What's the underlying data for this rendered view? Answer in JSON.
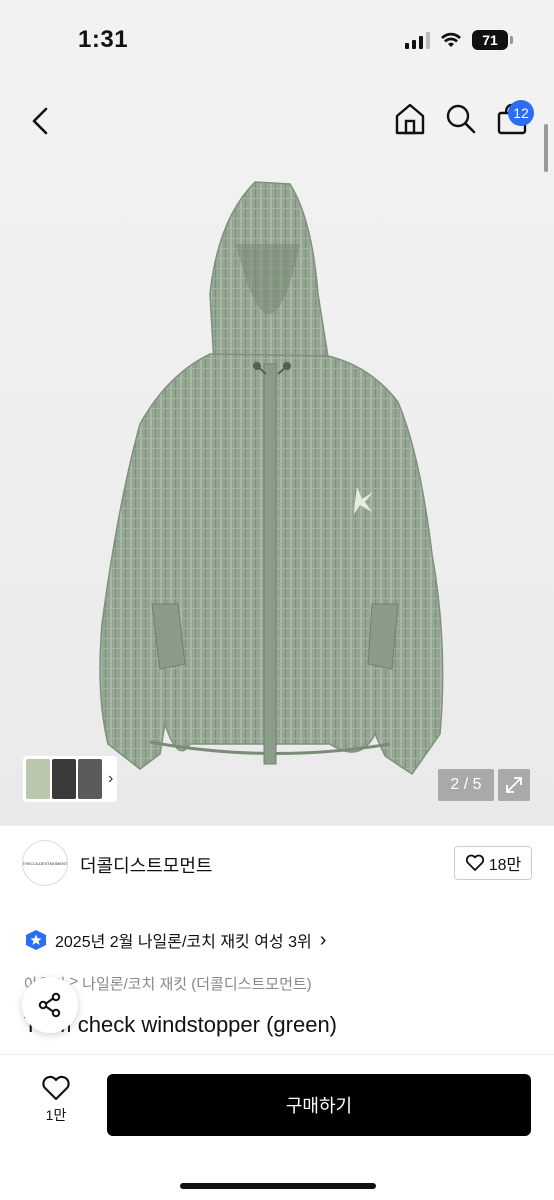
{
  "status": {
    "time": "1:31",
    "battery": "71"
  },
  "nav": {
    "cart_count": "12"
  },
  "gallery": {
    "page_counter": "2 / 5"
  },
  "shop": {
    "logo_text": "THECOLDESTMOMENT",
    "name": "더콜디스트모먼트",
    "likes": "18만"
  },
  "ranking": {
    "text": "2025년 2월 나일론/코치 재킷 여성 3위",
    "arrow": "›"
  },
  "breadcrumb": {
    "items": [
      "아우터",
      "나일론/코치 재킷 (더콜디스트모먼트)"
    ],
    "separator": ">"
  },
  "product": {
    "title": "TCM check windstopper (green)"
  },
  "bottom": {
    "fav_count": "1만",
    "buy_label": "구매하기"
  },
  "colors": {
    "accent": "#2d6cf6",
    "jacket": "#8fa58d",
    "buy_button": "#000000"
  },
  "icons": [
    "back-icon",
    "home-icon",
    "search-icon",
    "cart-icon",
    "expand-icon",
    "heart-icon",
    "share-icon",
    "rank-star-icon"
  ]
}
